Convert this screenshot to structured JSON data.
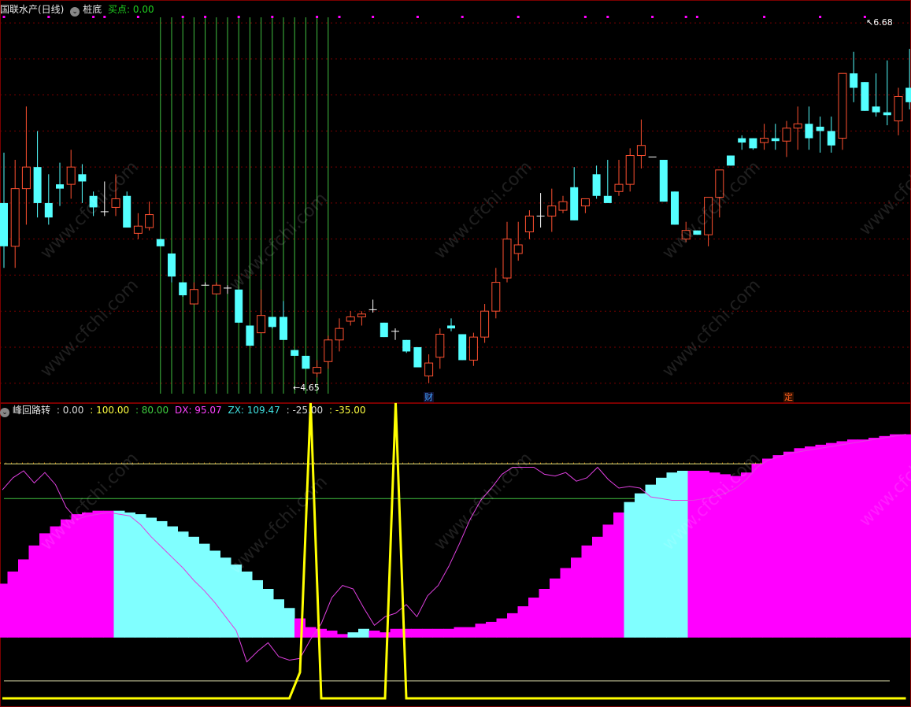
{
  "header": {
    "main_title": "国联水产(日线)",
    "indicator": "桩底",
    "buy_label": "买点: 0.00"
  },
  "sub_header": {
    "title": "峰回路转",
    "values": [
      ": 0.00",
      ": 100.00",
      ": 80.00",
      "DX: 95.07",
      "ZX: 109.47",
      ": -25.00",
      ": -35.00"
    ]
  },
  "price_labels": {
    "high": "6.68",
    "low": "4.65"
  },
  "badges": {
    "cai": "财",
    "ding": "定"
  },
  "watermark": "www.cfchi.com",
  "colors": {
    "up": "#ff5030",
    "down": "#54ffff",
    "magenta": "#ff00ff",
    "cyan_bar": "#80ffff",
    "yellow": "#ffff00",
    "green_line": "#40c040",
    "grid": "#7a0000"
  },
  "chart_data": [
    {
      "type": "candlestick",
      "title": "国联水产(日线)",
      "ylim": [
        4.4,
        7.05
      ],
      "candles": [
        [
          5.75,
          6.1,
          5.3,
          5.45
        ],
        [
          5.45,
          6.05,
          5.3,
          5.85
        ],
        [
          5.85,
          6.42,
          5.6,
          6.0
        ],
        [
          6.0,
          6.25,
          5.65,
          5.75
        ],
        [
          5.75,
          5.95,
          5.6,
          5.65
        ],
        [
          5.88,
          6.03,
          5.73,
          5.85
        ],
        [
          5.88,
          6.12,
          5.78,
          6.0
        ],
        [
          5.95,
          6.02,
          5.75,
          5.9
        ],
        [
          5.8,
          5.83,
          5.66,
          5.72
        ],
        [
          5.69,
          5.9,
          5.66,
          5.69
        ],
        [
          5.72,
          5.95,
          5.66,
          5.78
        ],
        [
          5.8,
          5.83,
          5.58,
          5.58
        ],
        [
          5.54,
          5.68,
          5.5,
          5.59
        ],
        [
          5.58,
          5.76,
          5.56,
          5.67
        ],
        [
          5.5,
          5.5,
          5.45,
          5.45
        ],
        [
          5.4,
          5.4,
          5.2,
          5.24
        ],
        [
          5.2,
          5.2,
          5.1,
          5.11
        ],
        [
          5.05,
          5.2,
          5.05,
          5.15
        ],
        [
          5.18,
          5.2,
          5.18,
          5.18
        ],
        [
          5.12,
          5.2,
          5.12,
          5.18
        ],
        [
          5.15,
          5.18,
          5.12,
          5.16
        ],
        [
          5.15,
          5.15,
          4.92,
          4.92
        ],
        [
          4.9,
          4.9,
          4.76,
          4.76
        ],
        [
          4.85,
          5.15,
          4.85,
          4.97
        ],
        [
          4.96,
          4.96,
          4.88,
          4.89
        ],
        [
          4.96,
          5.07,
          4.8,
          4.8
        ],
        [
          4.73,
          4.73,
          4.69,
          4.69
        ],
        [
          4.69,
          4.69,
          4.6,
          4.6
        ],
        [
          4.57,
          4.66,
          4.54,
          4.61
        ],
        [
          4.65,
          4.83,
          4.6,
          4.8
        ],
        [
          4.8,
          4.95,
          4.72,
          4.88
        ],
        [
          4.93,
          5.0,
          4.9,
          4.96
        ],
        [
          4.96,
          5.0,
          4.9,
          4.98
        ],
        [
          5.01,
          5.08,
          4.99,
          5.0
        ],
        [
          4.92,
          4.92,
          4.82,
          4.82
        ],
        [
          4.85,
          4.88,
          4.8,
          4.86
        ],
        [
          4.8,
          4.8,
          4.71,
          4.72
        ],
        [
          4.75,
          4.75,
          4.62,
          4.61
        ],
        [
          4.55,
          4.7,
          4.5,
          4.64
        ],
        [
          4.68,
          4.88,
          4.6,
          4.84
        ],
        [
          4.9,
          4.95,
          4.86,
          4.88
        ],
        [
          4.84,
          4.84,
          4.66,
          4.66
        ],
        [
          4.66,
          4.85,
          4.62,
          4.82
        ],
        [
          4.82,
          5.05,
          4.78,
          5.0
        ],
        [
          5.0,
          5.3,
          4.95,
          5.2
        ],
        [
          5.23,
          5.62,
          5.2,
          5.5
        ],
        [
          5.4,
          5.62,
          5.35,
          5.46
        ],
        [
          5.55,
          5.7,
          5.5,
          5.66
        ],
        [
          5.66,
          5.82,
          5.58,
          5.66
        ],
        [
          5.66,
          5.85,
          5.55,
          5.73
        ],
        [
          5.7,
          5.8,
          5.68,
          5.76
        ],
        [
          5.86,
          6.0,
          5.63,
          5.63
        ],
        [
          5.73,
          5.73,
          5.68,
          5.78
        ],
        [
          5.95,
          6.01,
          5.78,
          5.8
        ],
        [
          5.8,
          6.05,
          5.8,
          5.75
        ],
        [
          5.83,
          6.05,
          5.8,
          5.88
        ],
        [
          5.88,
          6.13,
          5.83,
          6.08
        ],
        [
          6.08,
          6.33,
          5.99,
          6.15
        ],
        [
          6.07,
          6.07,
          6.07,
          6.07
        ],
        [
          6.05,
          6.05,
          5.76,
          5.76
        ],
        [
          5.83,
          5.83,
          5.6,
          5.6
        ],
        [
          5.5,
          5.62,
          5.48,
          5.56
        ],
        [
          5.56,
          5.56,
          5.53,
          5.53
        ],
        [
          5.53,
          5.75,
          5.45,
          5.79
        ],
        [
          5.79,
          5.98,
          5.65,
          5.98
        ],
        [
          6.08,
          6.08,
          6.01,
          6.01
        ],
        [
          6.2,
          6.22,
          6.12,
          6.17
        ],
        [
          6.2,
          6.2,
          6.12,
          6.13
        ],
        [
          6.17,
          6.3,
          6.12,
          6.2
        ],
        [
          6.2,
          6.3,
          6.12,
          6.18
        ],
        [
          6.18,
          6.32,
          6.07,
          6.27
        ],
        [
          6.27,
          6.42,
          6.12,
          6.3
        ],
        [
          6.3,
          6.42,
          6.12,
          6.2
        ],
        [
          6.28,
          6.35,
          6.1,
          6.25
        ],
        [
          6.25,
          6.35,
          6.1,
          6.15
        ],
        [
          6.2,
          6.6,
          6.12,
          6.65
        ],
        [
          6.65,
          6.8,
          6.45,
          6.55
        ],
        [
          6.59,
          6.59,
          6.39,
          6.39
        ],
        [
          6.42,
          6.65,
          6.35,
          6.38
        ],
        [
          6.38,
          6.74,
          6.29,
          6.36
        ],
        [
          6.32,
          6.55,
          6.22,
          6.49
        ],
        [
          6.55,
          6.82,
          6.4,
          6.45
        ],
        [
          6.53,
          6.67,
          6.33,
          6.67
        ],
        [
          6.79,
          6.79,
          6.71,
          6.71
        ],
        [
          6.65,
          6.68,
          6.7,
          6.67
        ],
        [
          6.73,
          6.78,
          6.62,
          6.49
        ]
      ]
    },
    {
      "type": "bar",
      "title": "峰回路转",
      "ylim": [
        -35,
        120
      ],
      "reference_lines": [
        0,
        100,
        80,
        -25,
        -35
      ],
      "bars": [
        31,
        38,
        45,
        53,
        60,
        64,
        68,
        71,
        72,
        73,
        73,
        73,
        72,
        71,
        69,
        67,
        64,
        61,
        58,
        54,
        50,
        46,
        42,
        38,
        33,
        28,
        22,
        17,
        11,
        6,
        5,
        4,
        2,
        3,
        5,
        4,
        3,
        5,
        5,
        5,
        5,
        5,
        5,
        6,
        6,
        8,
        9,
        11,
        14,
        18,
        23,
        28,
        34,
        40,
        46,
        53,
        58,
        65,
        72,
        78,
        83,
        88,
        92,
        95,
        96,
        96,
        96,
        95,
        94,
        93,
        95,
        100,
        103,
        105,
        107,
        109,
        110,
        111,
        112,
        113,
        114,
        114,
        115,
        116,
        117,
        117
      ],
      "bar_colors": [
        "m",
        "m",
        "m",
        "m",
        "m",
        "m",
        "m",
        "m",
        "m",
        "m",
        "m",
        "c",
        "c",
        "c",
        "c",
        "c",
        "c",
        "c",
        "c",
        "c",
        "c",
        "c",
        "c",
        "c",
        "c",
        "c",
        "c",
        "c",
        "m",
        "m",
        "m",
        "m",
        "m",
        "c",
        "c",
        "m",
        "m",
        "m",
        "m",
        "m",
        "m",
        "m",
        "m",
        "m",
        "m",
        "m",
        "m",
        "m",
        "m",
        "m",
        "m",
        "m",
        "m",
        "m",
        "m",
        "m",
        "m",
        "m",
        "m",
        "c",
        "c",
        "c",
        "c",
        "c",
        "c",
        "m",
        "m",
        "m",
        "m",
        "m",
        "m",
        "m",
        "m",
        "m",
        "m",
        "m",
        "m",
        "m",
        "m",
        "m",
        "m",
        "m",
        "m",
        "m",
        "m",
        "m"
      ],
      "signal_line": [
        -35,
        -35,
        -35,
        -35,
        -35,
        -35,
        -35,
        -35,
        -35,
        -35,
        -35,
        -35,
        -35,
        -35,
        -35,
        -35,
        -35,
        -35,
        -35,
        -35,
        -35,
        -35,
        -35,
        -35,
        -35,
        -35,
        -35,
        -35,
        -20,
        135,
        -35,
        -35,
        -35,
        -35,
        -35,
        -35,
        -35,
        135,
        -35,
        -35,
        -35,
        -35,
        -35,
        -35,
        -35,
        -35,
        -35,
        -35,
        -35,
        -35,
        -35,
        -35,
        -35,
        -35,
        -35,
        -35,
        -35,
        -35,
        -35,
        -35,
        -35,
        -35,
        -35,
        -35,
        -35,
        -35,
        -35,
        -35,
        -35,
        -35,
        -35,
        -35,
        -35,
        -35,
        -35,
        -35,
        -35,
        -35,
        -35,
        -35,
        -35,
        -35,
        -35,
        -35,
        -35,
        -35
      ],
      "dx_line": [
        85,
        92,
        96,
        89,
        95,
        88,
        75,
        68,
        70,
        71,
        72,
        71,
        70,
        65,
        58,
        52,
        46,
        40,
        33,
        27,
        20,
        12,
        4,
        -14,
        -8,
        -3,
        -11,
        -13,
        -12,
        -1,
        8,
        23,
        30,
        28,
        17,
        7,
        12,
        14,
        19,
        12,
        24,
        30,
        41,
        54,
        68,
        79,
        86,
        94,
        98,
        98,
        98,
        94,
        93,
        95,
        90,
        92,
        98,
        91,
        86,
        87,
        86,
        81,
        80,
        79,
        79,
        79,
        80,
        81,
        83,
        86,
        91,
        98,
        102,
        104,
        106,
        107,
        108,
        109,
        110,
        111,
        112,
        113,
        114,
        115,
        116,
        117
      ],
      "dx_value": 95.07,
      "zx_value": 109.47
    }
  ]
}
